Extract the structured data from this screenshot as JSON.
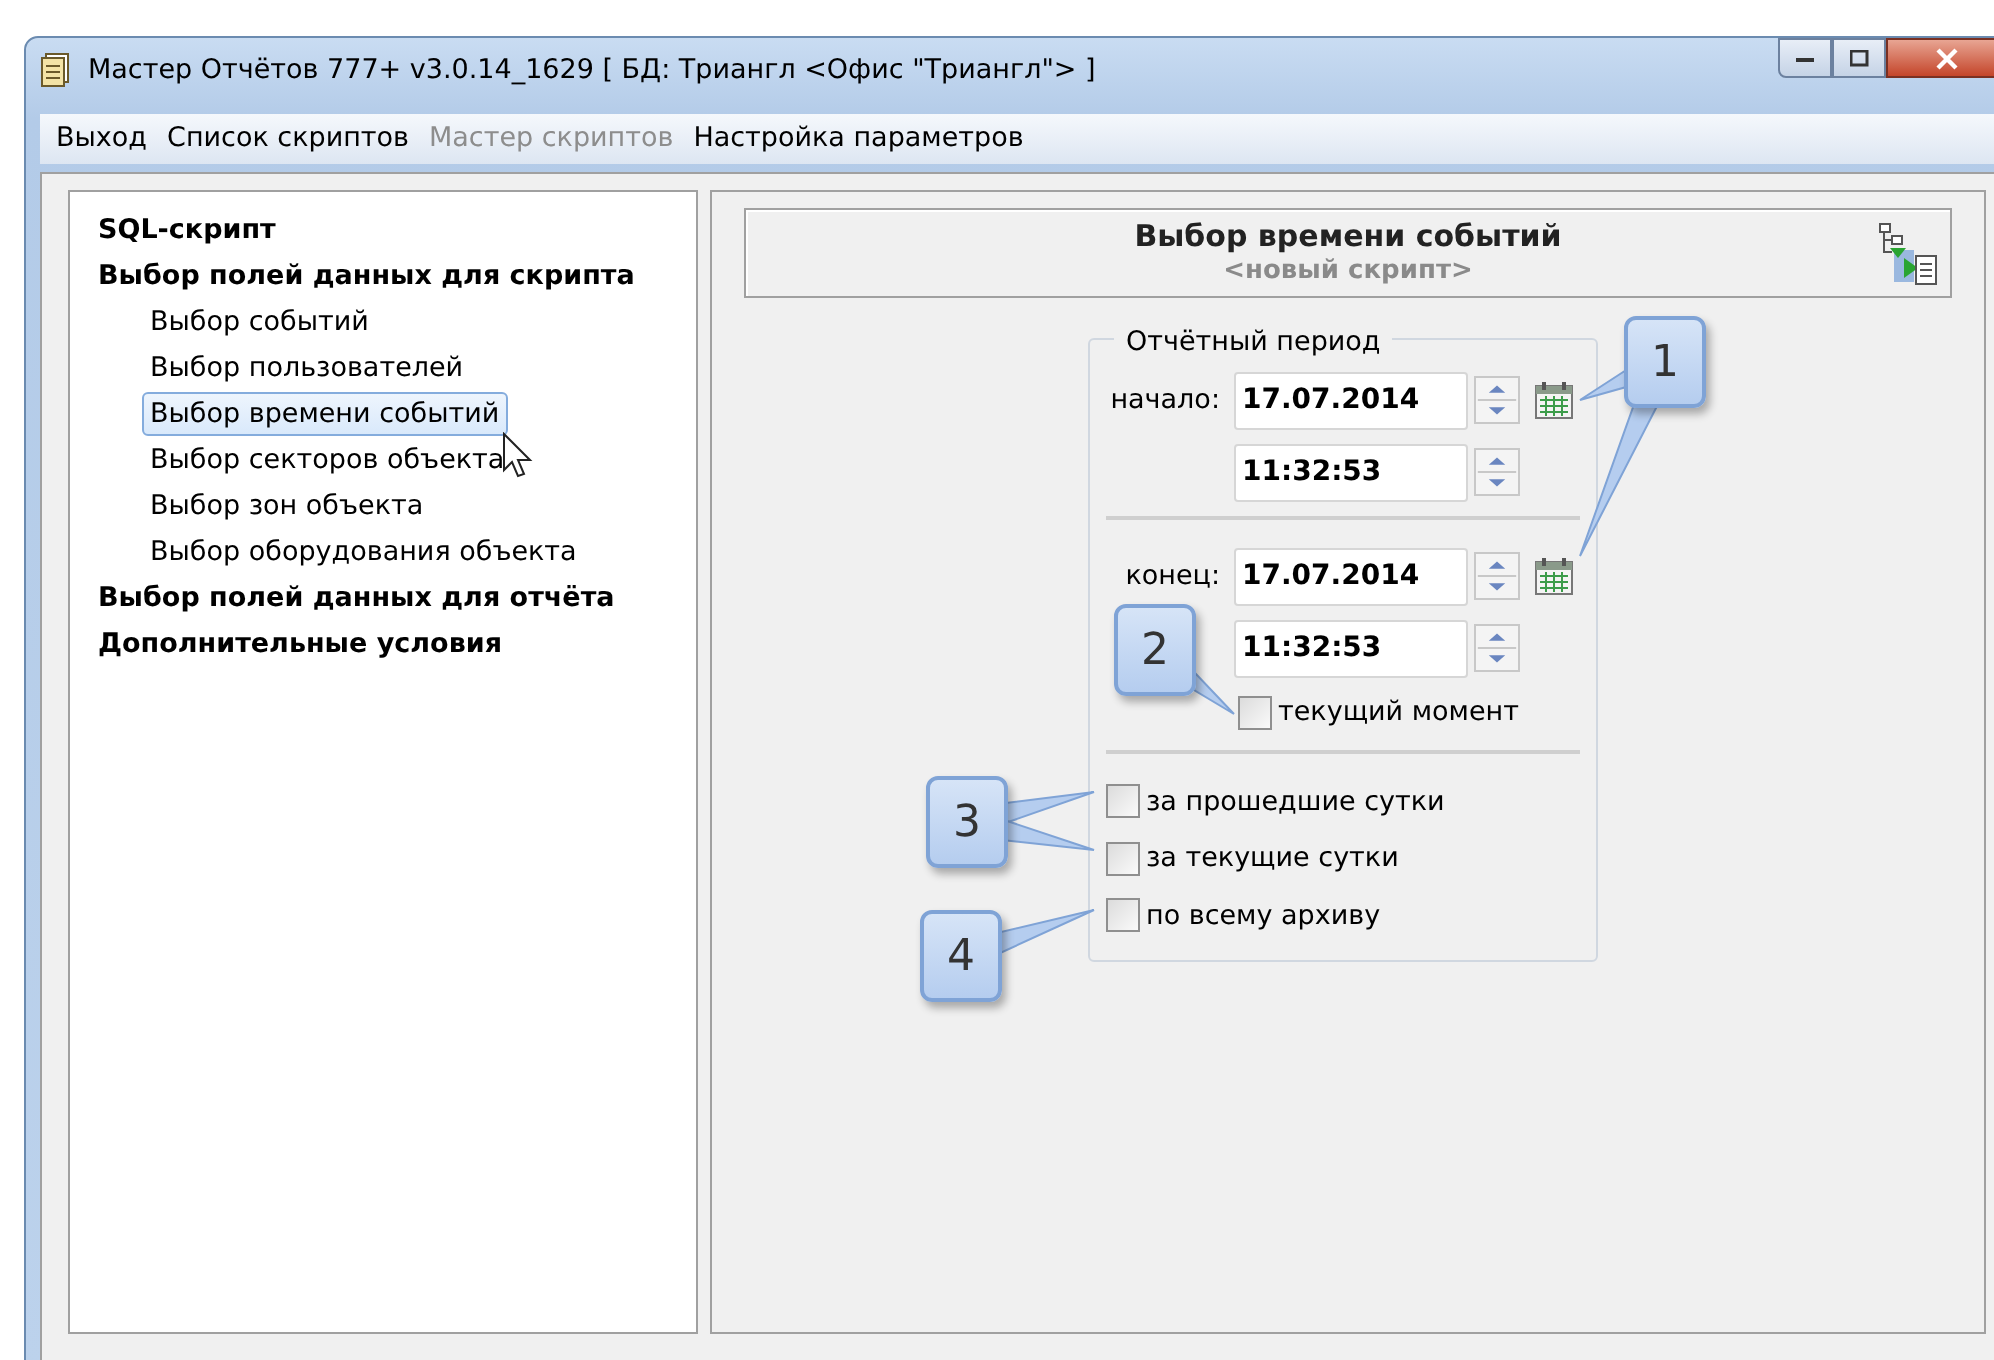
{
  "window": {
    "title": "Мастер Отчётов 777+ v3.0.14_1629 [ БД: Триангл <Офис \"Триангл\"> ]"
  },
  "menu": [
    {
      "label": "Выход",
      "disabled": false
    },
    {
      "label": "Список скриптов",
      "disabled": false
    },
    {
      "label": "Мастер скриптов",
      "disabled": true
    },
    {
      "label": "Настройка параметров",
      "disabled": false
    }
  ],
  "tree": [
    {
      "label": "SQL-скрипт",
      "selected": false
    },
    {
      "label": "Выбор полей данных для скрипта",
      "selected": false,
      "children": [
        {
          "label": "Выбор событий",
          "selected": false
        },
        {
          "label": "Выбор пользователей",
          "selected": false
        },
        {
          "label": "Выбор времени событий",
          "selected": true
        },
        {
          "label": "Выбор секторов объекта",
          "selected": false
        },
        {
          "label": "Выбор зон объекта",
          "selected": false
        },
        {
          "label": "Выбор оборудования объекта",
          "selected": false
        }
      ]
    },
    {
      "label": "Выбор полей данных для отчёта",
      "selected": false
    },
    {
      "label": "Дополнительные условия",
      "selected": false
    }
  ],
  "header": {
    "title": "Выбор времени событий",
    "subtitle": "<новый скрипт>"
  },
  "period": {
    "legend": "Отчётный период",
    "start": {
      "label": "начало:",
      "date": "17.07.2014",
      "time": "11:32:53"
    },
    "end": {
      "label": "конец:",
      "date": "17.07.2014",
      "time": "11:32:53"
    },
    "now": {
      "label": "текущий момент",
      "checked": false
    }
  },
  "options": [
    {
      "label": "за прошедшие сутки",
      "checked": false
    },
    {
      "label": "за текущие сутки",
      "checked": false
    },
    {
      "label": "по всему архиву",
      "checked": false
    }
  ],
  "callouts": [
    {
      "number": "1"
    },
    {
      "number": "2"
    },
    {
      "number": "3"
    },
    {
      "number": "4"
    }
  ]
}
